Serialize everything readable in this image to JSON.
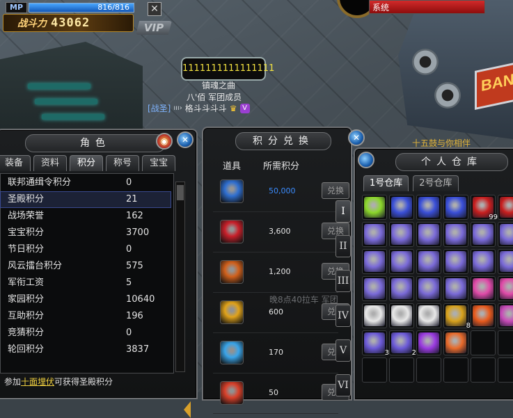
{
  "hud": {
    "mp_label": "MP",
    "mp_value": "816/816",
    "mp_fill": 1.0,
    "power_label": "战斗力",
    "power_value": "43062",
    "close_glyph": "✕",
    "vip_label": "VIP",
    "system_label": "系统"
  },
  "npc": {
    "number_tag": "1111111111111111",
    "line1": "镇魂之曲",
    "line2": "八'佰 军团成员",
    "guild": "[战圣]",
    "mark": "ııı›",
    "name": "格斗斗斗斗",
    "crown": "♛",
    "vip_badge": "V"
  },
  "right_tip": "十五鼓与你相伴",
  "role_panel": {
    "title": "角色",
    "tabs": [
      "装备",
      "资料",
      "积分",
      "称号",
      "宝宝"
    ],
    "active_tab": 2,
    "rows": [
      {
        "name": "联邦通缉令积分",
        "value": "0"
      },
      {
        "name": "圣殿积分",
        "value": "21"
      },
      {
        "name": "战场荣誉",
        "value": "162"
      },
      {
        "name": "宝宝积分",
        "value": "3700"
      },
      {
        "name": "节日积分",
        "value": "0"
      },
      {
        "name": "风云擂台积分",
        "value": "575"
      },
      {
        "name": "军衔工资",
        "value": "5"
      },
      {
        "name": "家园积分",
        "value": "10640"
      },
      {
        "name": "互助积分",
        "value": "196"
      },
      {
        "name": "竞猜积分",
        "value": "0"
      },
      {
        "name": "轮回积分",
        "value": "3837"
      }
    ],
    "selected_row": 1,
    "hint_prefix": "参加",
    "hint_link": "十面埋伏",
    "hint_suffix": "可获得圣殿积分"
  },
  "exchange_panel": {
    "title": "积分兑换",
    "col_item": "道具",
    "col_cost": "所需积分",
    "items": [
      {
        "cost": "50,000",
        "button": "兑换",
        "icon": "blue-chest-icon",
        "color": "#2f6fd0",
        "cost_color": "#3b8cff"
      },
      {
        "cost": "3,600",
        "button": "兑换",
        "icon": "red-chest-icon",
        "color": "#c8202a",
        "cost_color": "#e6e6e6"
      },
      {
        "cost": "1,200",
        "button": "兑换",
        "icon": "orange-chest-icon",
        "color": "#d0601c",
        "cost_color": "#e6e6e6"
      },
      {
        "cost": "600",
        "button": "兑换",
        "icon": "gold-crystal-icon",
        "color": "#e0a21a",
        "cost_color": "#e6e6e6"
      },
      {
        "cost": "170",
        "button": "兑换",
        "icon": "blue-crystal-icon",
        "color": "#3aa4e8",
        "cost_color": "#e6e6e6"
      },
      {
        "cost": "50",
        "button": "兑换",
        "icon": "red-crystal-icon",
        "color": "#d8402a",
        "cost_color": "#e6e6e6"
      }
    ],
    "pages": [
      "I",
      "II",
      "III",
      "IV",
      "V",
      "VI"
    ],
    "active_page": 0,
    "ghost_text": "晚8点40拉车 军团"
  },
  "warehouse_panel": {
    "title": "个人仓库",
    "tabs": [
      "1号仓库",
      "2号仓库"
    ],
    "active_tab": 0,
    "slots": [
      {
        "icon": "green-star-card-icon",
        "color": "#8bd62a",
        "count": ""
      },
      {
        "icon": "star-card-icon",
        "color": "#3a4fd8",
        "count": ""
      },
      {
        "icon": "star-card-icon",
        "color": "#3a4fd8",
        "count": ""
      },
      {
        "icon": "star-card-icon",
        "color": "#3a4fd8",
        "count": ""
      },
      {
        "icon": "red-potion-icon",
        "color": "#c81e1e",
        "count": "99"
      },
      {
        "icon": "red-potion-icon",
        "color": "#c81e1e",
        "count": ""
      },
      {
        "icon": "chest-icon",
        "color": "#7a6ad8",
        "count": ""
      },
      {
        "icon": "chest-icon",
        "color": "#7a6ad8",
        "count": ""
      },
      {
        "icon": "chest-icon",
        "color": "#7a6ad8",
        "count": ""
      },
      {
        "icon": "chest-icon",
        "color": "#7a6ad8",
        "count": ""
      },
      {
        "icon": "chest-icon",
        "color": "#7a6ad8",
        "count": ""
      },
      {
        "icon": "chest-icon",
        "color": "#7a6ad8",
        "count": ""
      },
      {
        "icon": "chest-icon",
        "color": "#7a6ad8",
        "count": ""
      },
      {
        "icon": "chest-icon",
        "color": "#7a6ad8",
        "count": ""
      },
      {
        "icon": "chest-icon",
        "color": "#7a6ad8",
        "count": ""
      },
      {
        "icon": "chest-icon",
        "color": "#7a6ad8",
        "count": ""
      },
      {
        "icon": "chest-icon",
        "color": "#7a6ad8",
        "count": ""
      },
      {
        "icon": "chest-icon",
        "color": "#7a6ad8",
        "count": ""
      },
      {
        "icon": "chest-icon",
        "color": "#7a6ad8",
        "count": ""
      },
      {
        "icon": "chest-icon",
        "color": "#7a6ad8",
        "count": ""
      },
      {
        "icon": "chest-icon",
        "color": "#7a6ad8",
        "count": ""
      },
      {
        "icon": "chest-icon",
        "color": "#7a6ad8",
        "count": ""
      },
      {
        "icon": "pink-fairy-icon",
        "color": "#e04aa8",
        "count": ""
      },
      {
        "icon": "pink-fairy-icon",
        "color": "#e04aa8",
        "count": ""
      },
      {
        "icon": "white-orb-icon",
        "color": "#e8e8e8",
        "count": ""
      },
      {
        "icon": "white-orb-icon",
        "color": "#e8e8e8",
        "count": ""
      },
      {
        "icon": "white-orb-icon",
        "color": "#e8e8e8",
        "count": ""
      },
      {
        "icon": "gold-egg-icon",
        "color": "#d8a21c",
        "count": "8"
      },
      {
        "icon": "gift-box-icon",
        "color": "#e85a1c",
        "count": ""
      },
      {
        "icon": "fairy-icon",
        "color": "#c84ab8",
        "count": ""
      },
      {
        "icon": "mask-icon",
        "color": "#6c5ad8",
        "count": "3"
      },
      {
        "icon": "mask-icon",
        "color": "#6c5ad8",
        "count": "2"
      },
      {
        "icon": "purple-eye-icon",
        "color": "#9a3ae0",
        "count": ""
      },
      {
        "icon": "fox-pet-icon",
        "color": "#e86a2a",
        "count": ""
      },
      {
        "icon": "",
        "color": "",
        "count": ""
      },
      {
        "icon": "",
        "color": "",
        "count": ""
      },
      {
        "icon": "",
        "color": "",
        "count": ""
      },
      {
        "icon": "",
        "color": "",
        "count": ""
      },
      {
        "icon": "",
        "color": "",
        "count": ""
      },
      {
        "icon": "",
        "color": "",
        "count": ""
      },
      {
        "icon": "",
        "color": "",
        "count": ""
      },
      {
        "icon": "",
        "color": "",
        "count": ""
      }
    ]
  },
  "panel_icons": {
    "close_orb": "✕",
    "role_orb_left": "◉"
  }
}
